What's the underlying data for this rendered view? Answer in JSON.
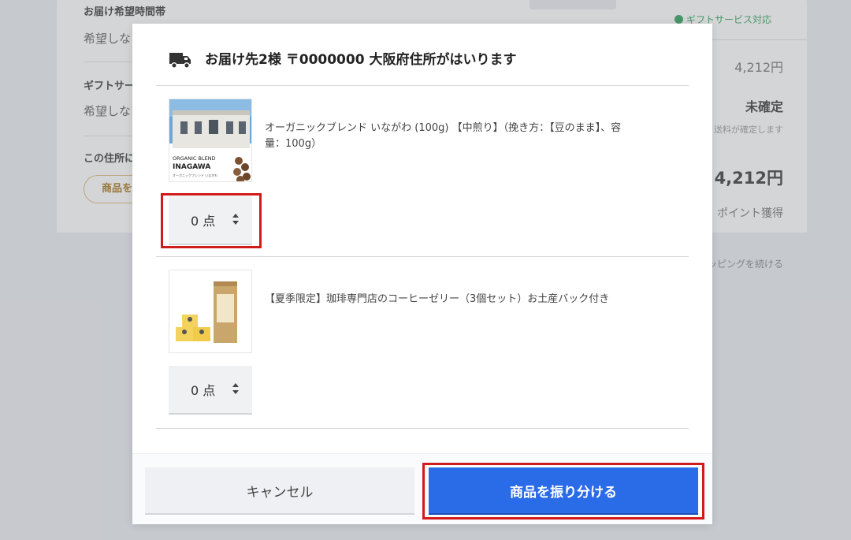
{
  "background": {
    "delivery_time_label": "お届け希望時間帯",
    "delivery_time_value": "希望しない",
    "gift_label": "ギフトサービス",
    "gift_value": "希望しない",
    "address_label": "この住所に",
    "assign_button": "商品を振り分ける",
    "gift_service": "ギフトサービス対応",
    "subtotal": "4,212円",
    "shipping_status": "未確定",
    "shipping_note": "送料が確定します",
    "total": "4,212円",
    "points": "ポイント獲得",
    "continue_shopping": "ショッピングを続ける"
  },
  "modal": {
    "title": "お届け先2様 〒0000000 大阪府住所がはいります",
    "items": [
      {
        "name": "オーガニックブレンド いながわ (100g) 【中煎り】（挽き方：【豆のまま】、容量：100g）",
        "image_text_1": "ORGANIC BLEND",
        "image_text_2": "INAGAWA",
        "image_text_3": "オーガニックブレンド いながわ",
        "qty_label": "0 点"
      },
      {
        "name": "【夏季限定】珈琲専門店のコーヒーゼリー（3個セット）お土産バック付き",
        "qty_label": "0 点"
      }
    ],
    "cancel_label": "キャンセル",
    "submit_label": "商品を振り分ける"
  },
  "colors": {
    "primary": "#2a6be8",
    "highlight": "#d11a1a",
    "gift_green": "#4caf72"
  }
}
